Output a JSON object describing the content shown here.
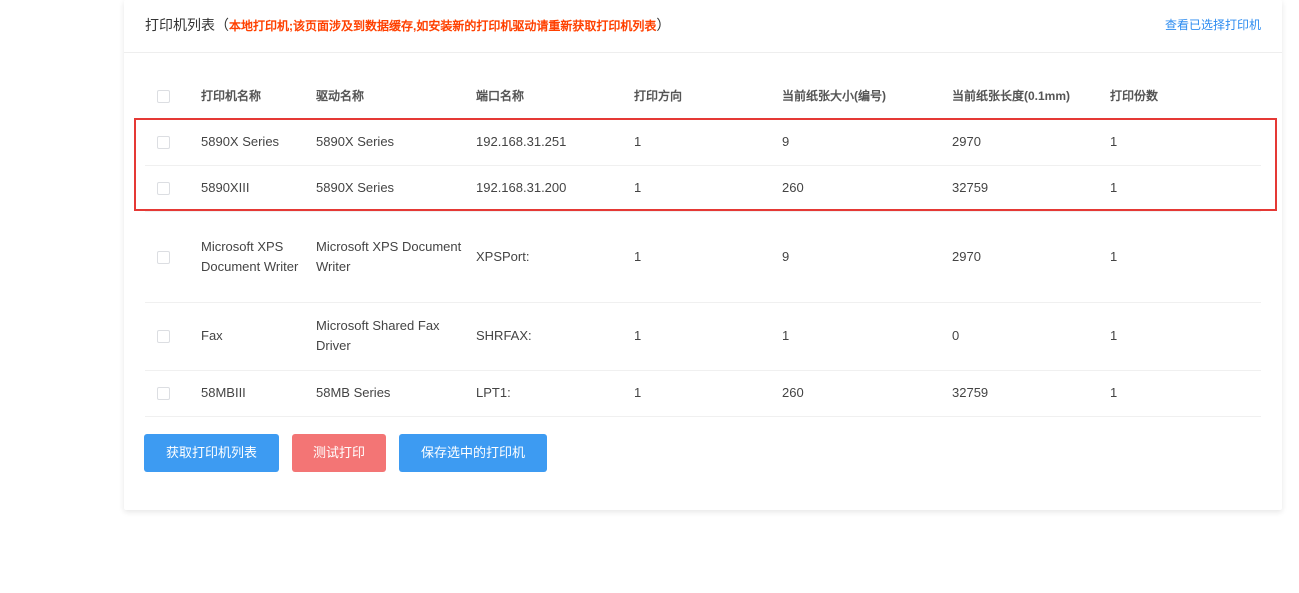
{
  "header": {
    "title": "打印机列表",
    "paren_open": "（",
    "warning": "本地打印机;该页面涉及到数据缓存,如安装新的打印机驱动请重新获取打印机列表",
    "paren_close": "）",
    "link": "查看已选择打印机"
  },
  "colors": {
    "accent": "#2d8cf0",
    "warning": "#ff4000",
    "highlight_border": "#e53935",
    "button_blue": "#3d9bf2",
    "button_red": "#f37575"
  },
  "table": {
    "columns": [
      "打印机名称",
      "驱动名称",
      "端口名称",
      "打印方向",
      "当前纸张大小(编号)",
      "当前纸张长度(0.1mm)",
      "打印份数"
    ],
    "rows": [
      [
        "5890X Series",
        "5890X Series",
        "192.168.31.251",
        "1",
        "9",
        "2970",
        "1"
      ],
      [
        "5890XIII",
        "5890X Series",
        "192.168.31.200",
        "1",
        "260",
        "32759",
        "1"
      ],
      [
        "Microsoft XPS Document Writer",
        "Microsoft XPS Document Writer",
        "XPSPort:",
        "1",
        "9",
        "2970",
        "1"
      ],
      [
        "Fax",
        "Microsoft Shared Fax Driver",
        "SHRFAX:",
        "1",
        "1",
        "0",
        "1"
      ],
      [
        "58MBIII",
        "58MB Series",
        "LPT1:",
        "1",
        "260",
        "32759",
        "1"
      ]
    ]
  },
  "buttons": {
    "get_list": "获取打印机列表",
    "test_print": "测试打印",
    "save_selected": "保存选中的打印机"
  }
}
